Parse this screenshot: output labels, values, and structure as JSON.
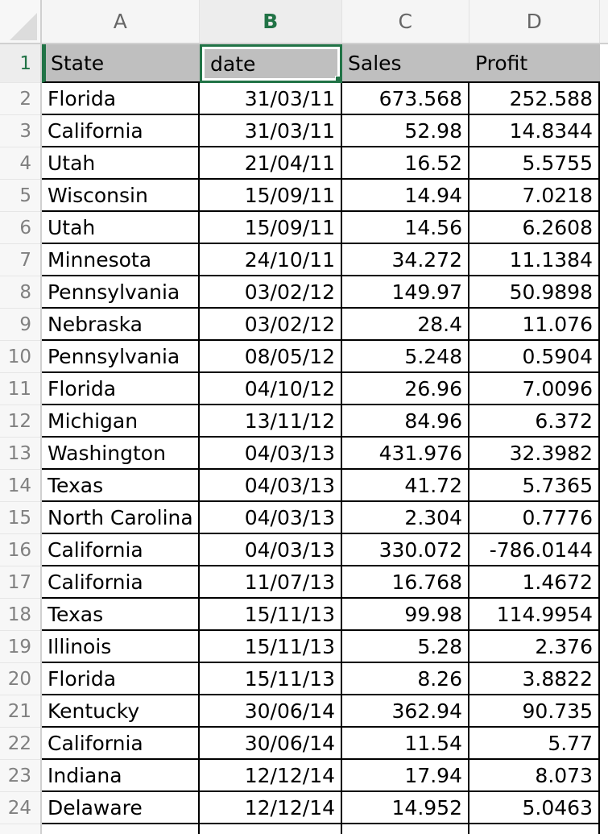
{
  "app": {
    "type": "spreadsheet",
    "accent_color": "#217346",
    "header_fill": "#bfbfbf",
    "gridline_color": "#000000",
    "select_all_icon": "select-all-corner-icon"
  },
  "columns": {
    "letters": [
      "A",
      "B",
      "C",
      "D"
    ],
    "selected_letter": "B"
  },
  "selection": {
    "active_cell": "B1",
    "active_value": "date",
    "selected_row_number": "1"
  },
  "table": {
    "headers": [
      "State",
      "date",
      "Sales",
      "Profit"
    ],
    "rows": [
      {
        "n": "2",
        "state": "Florida",
        "date": "31/03/11",
        "sales": "673.568",
        "profit": "252.588"
      },
      {
        "n": "3",
        "state": "California",
        "date": "31/03/11",
        "sales": "52.98",
        "profit": "14.8344"
      },
      {
        "n": "4",
        "state": "Utah",
        "date": "21/04/11",
        "sales": "16.52",
        "profit": "5.5755"
      },
      {
        "n": "5",
        "state": "Wisconsin",
        "date": "15/09/11",
        "sales": "14.94",
        "profit": "7.0218"
      },
      {
        "n": "6",
        "state": "Utah",
        "date": "15/09/11",
        "sales": "14.56",
        "profit": "6.2608"
      },
      {
        "n": "7",
        "state": "Minnesota",
        "date": "24/10/11",
        "sales": "34.272",
        "profit": "11.1384"
      },
      {
        "n": "8",
        "state": "Pennsylvania",
        "date": "03/02/12",
        "sales": "149.97",
        "profit": "50.9898"
      },
      {
        "n": "9",
        "state": "Nebraska",
        "date": "03/02/12",
        "sales": "28.4",
        "profit": "11.076"
      },
      {
        "n": "10",
        "state": "Pennsylvania",
        "date": "08/05/12",
        "sales": "5.248",
        "profit": "0.5904"
      },
      {
        "n": "11",
        "state": "Florida",
        "date": "04/10/12",
        "sales": "26.96",
        "profit": "7.0096"
      },
      {
        "n": "12",
        "state": "Michigan",
        "date": "13/11/12",
        "sales": "84.96",
        "profit": "6.372"
      },
      {
        "n": "13",
        "state": "Washington",
        "date": "04/03/13",
        "sales": "431.976",
        "profit": "32.3982"
      },
      {
        "n": "14",
        "state": "Texas",
        "date": "04/03/13",
        "sales": "41.72",
        "profit": "5.7365"
      },
      {
        "n": "15",
        "state": "North Carolina",
        "date": "04/03/13",
        "sales": "2.304",
        "profit": "0.7776"
      },
      {
        "n": "16",
        "state": "California",
        "date": "04/03/13",
        "sales": "330.072",
        "profit": "-786.0144"
      },
      {
        "n": "17",
        "state": "California",
        "date": "11/07/13",
        "sales": "16.768",
        "profit": "1.4672"
      },
      {
        "n": "18",
        "state": "Texas",
        "date": "15/11/13",
        "sales": "99.98",
        "profit": "114.9954"
      },
      {
        "n": "19",
        "state": "Illinois",
        "date": "15/11/13",
        "sales": "5.28",
        "profit": "2.376"
      },
      {
        "n": "20",
        "state": "Florida",
        "date": "15/11/13",
        "sales": "8.26",
        "profit": "3.8822"
      },
      {
        "n": "21",
        "state": "Kentucky",
        "date": "30/06/14",
        "sales": "362.94",
        "profit": "90.735"
      },
      {
        "n": "22",
        "state": "California",
        "date": "30/06/14",
        "sales": "11.54",
        "profit": "5.77"
      },
      {
        "n": "23",
        "state": "Indiana",
        "date": "12/12/14",
        "sales": "17.94",
        "profit": "8.073"
      },
      {
        "n": "24",
        "state": "Delaware",
        "date": "12/12/14",
        "sales": "14.952",
        "profit": "5.0463"
      }
    ]
  }
}
